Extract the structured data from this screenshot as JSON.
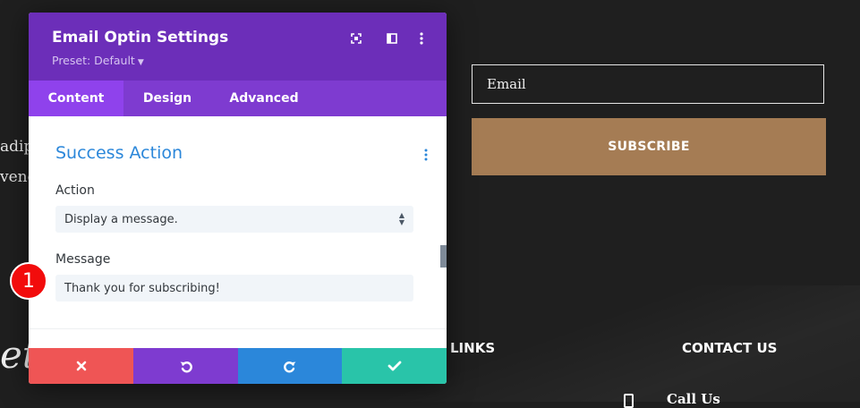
{
  "background": {
    "text_line_1": "adip",
    "text_line_2": "vene",
    "script_text": "et",
    "email_placeholder": "Email",
    "subscribe_label": "SUBSCRIBE",
    "footer_links_heading": "LINKS",
    "footer_contact_heading": "CONTACT US",
    "call_us": "Call Us"
  },
  "modal": {
    "title": "Email Optin Settings",
    "preset": "Preset: Default",
    "tabs": [
      {
        "label": "Content",
        "active": true
      },
      {
        "label": "Design",
        "active": false
      },
      {
        "label": "Advanced",
        "active": false
      }
    ],
    "section_title": "Success Action",
    "action_label": "Action",
    "action_value": "Display a message.",
    "message_label": "Message",
    "message_value": "Thank you for subscribing!"
  },
  "annotation": {
    "step": "1"
  },
  "colors": {
    "header_purple": "#6c2eb9",
    "tab_purple": "#7e3bd0",
    "active_tab": "#8f42ec",
    "section_blue": "#2b87da",
    "cancel_red": "#ef5555",
    "save_green": "#29c4a9",
    "subscribe_brown": "#a57c54",
    "badge_red": "#f20c0c"
  },
  "icons": {
    "expand": "expand-icon",
    "split": "split-view-icon",
    "more": "more-vertical-icon",
    "cancel": "close-icon",
    "undo": "undo-icon",
    "redo": "redo-icon",
    "save": "checkmark-icon"
  }
}
